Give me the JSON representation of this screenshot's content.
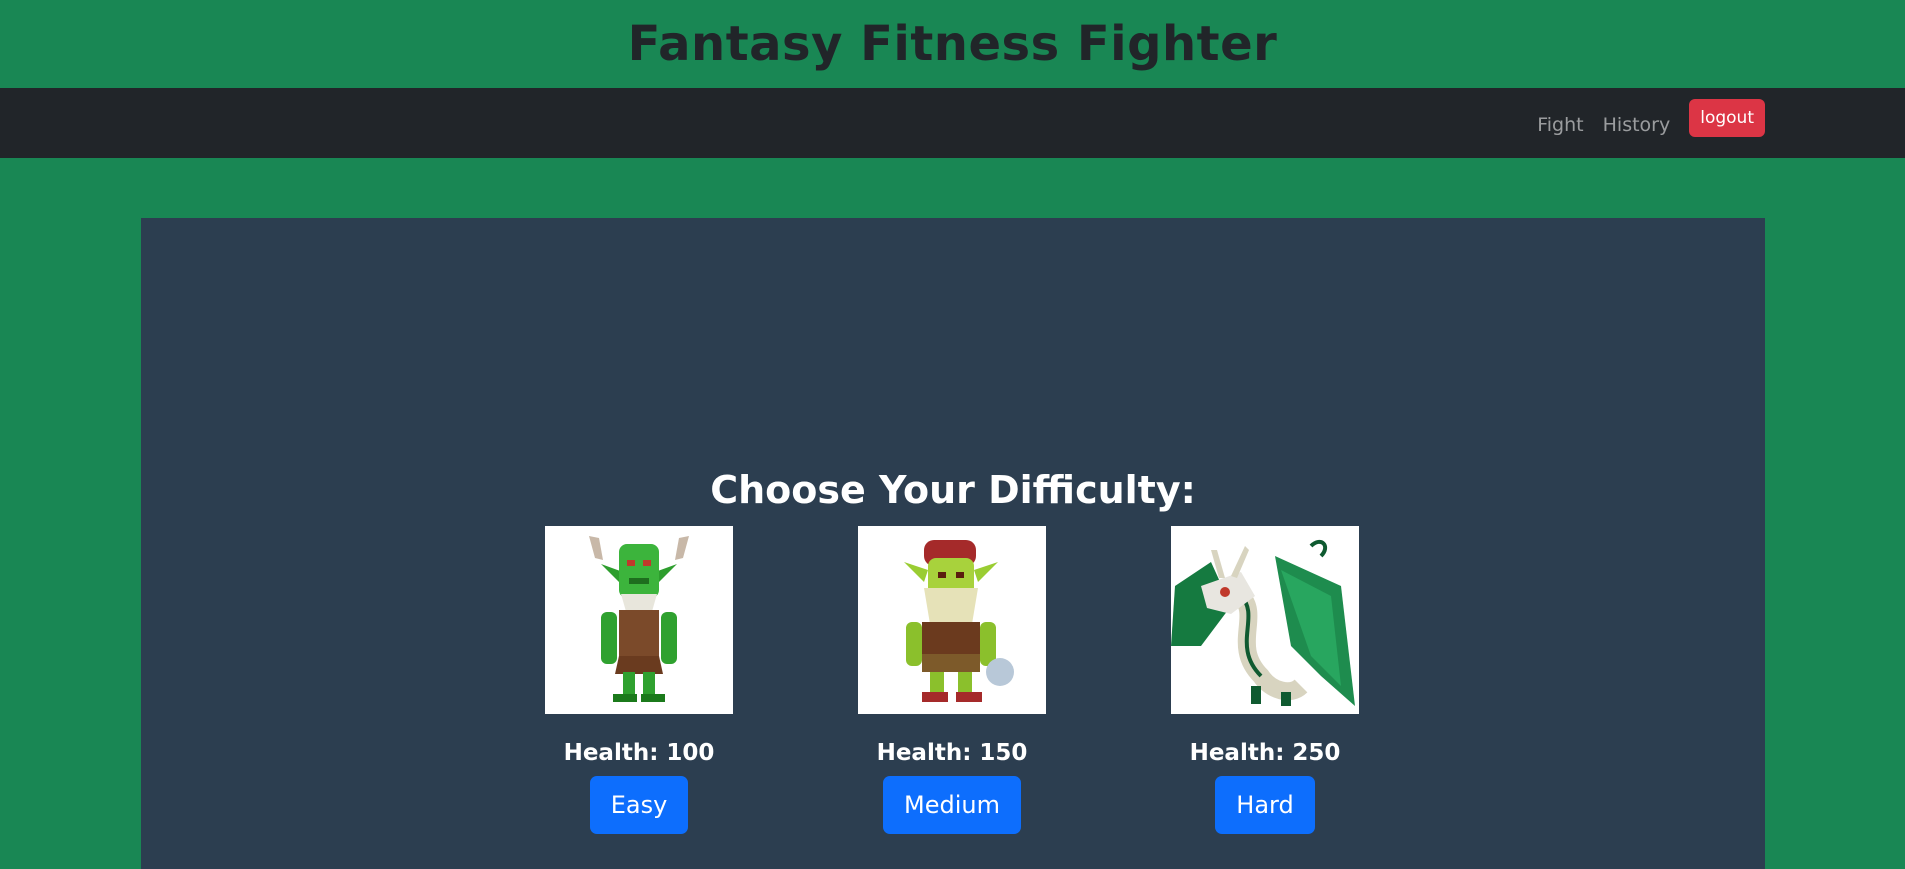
{
  "header": {
    "title": "Fantasy Fitness Fighter"
  },
  "nav": {
    "links": [
      "Fight",
      "History"
    ],
    "logout_label": "logout"
  },
  "main": {
    "heading": "Choose Your Difficulty:",
    "options": [
      {
        "monster_icon": "goblin-icon",
        "health": "Health: 100",
        "button": "Easy"
      },
      {
        "monster_icon": "troll-icon",
        "health": "Health: 150",
        "button": "Medium"
      },
      {
        "monster_icon": "dragon-icon",
        "health": "Health: 250",
        "button": "Hard"
      }
    ]
  },
  "colors": {
    "page_bg": "#198754",
    "navbar_bg": "#212529",
    "panel_bg": "#2c3e50",
    "logout": "#dc3545",
    "primary_button": "#0d6efd"
  }
}
